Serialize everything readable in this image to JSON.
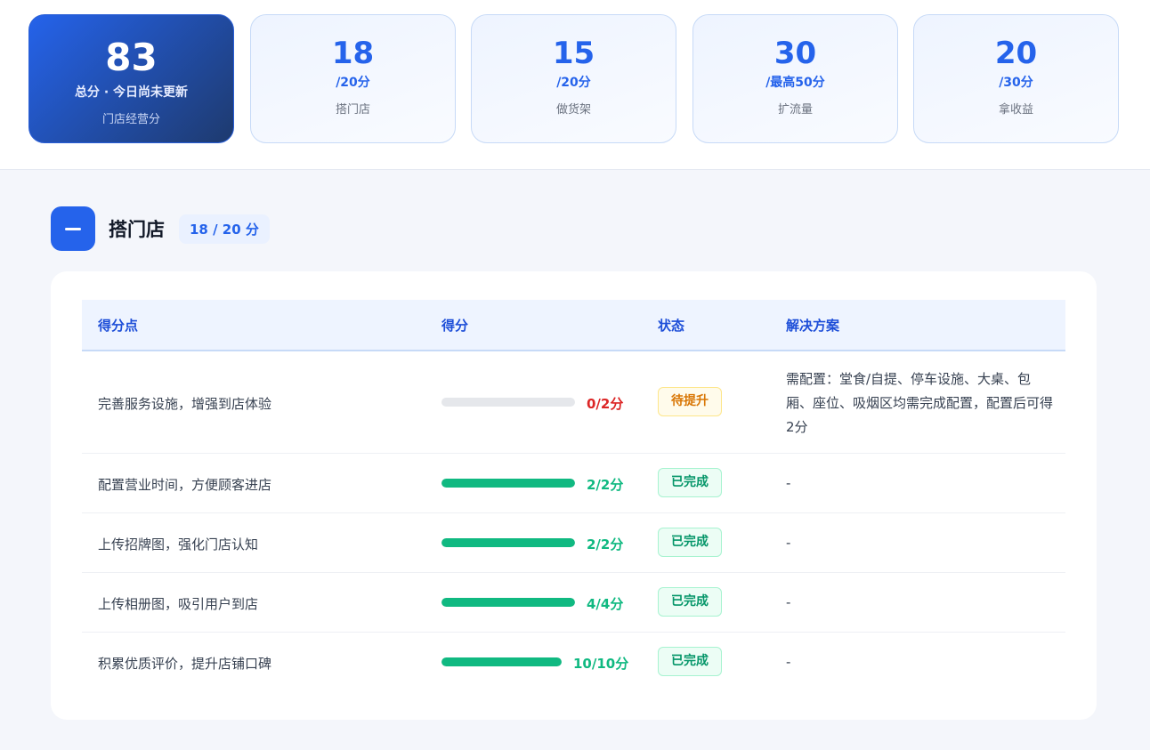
{
  "summary": {
    "total": {
      "value": "83",
      "subtitle": "总分 · 今日尚未更新",
      "caption": "门店经营分"
    },
    "cards": [
      {
        "value": "18",
        "max": "/20分",
        "caption": "搭门店"
      },
      {
        "value": "15",
        "max": "/20分",
        "caption": "做货架"
      },
      {
        "value": "30",
        "max": "/最高50分",
        "caption": "扩流量"
      },
      {
        "value": "20",
        "max": "/30分",
        "caption": "拿收益"
      }
    ]
  },
  "section": {
    "title": "搭门店",
    "score_pill": "18 / 20 分",
    "collapse_icon": "minus-icon"
  },
  "table": {
    "headers": [
      "得分点",
      "得分",
      "状态",
      "解决方案"
    ],
    "rows": [
      {
        "point": "完善服务设施，增强到店体验",
        "score": "0/2分",
        "progress": 0,
        "status": "待提升",
        "status_type": "pending",
        "solution": "需配置：堂食/自提、停车设施、大桌、包厢、座位、吸烟区均需完成配置，配置后可得2分"
      },
      {
        "point": "配置营业时间，方便顾客进店",
        "score": "2/2分",
        "progress": 1,
        "status": "已完成",
        "status_type": "done",
        "solution": "-"
      },
      {
        "point": "上传招牌图，强化门店认知",
        "score": "2/2分",
        "progress": 1,
        "status": "已完成",
        "status_type": "done",
        "solution": "-"
      },
      {
        "point": "上传相册图，吸引用户到店",
        "score": "4/4分",
        "progress": 1,
        "status": "已完成",
        "status_type": "done",
        "solution": "-"
      },
      {
        "point": "积累优质评价，提升店铺口碑",
        "score": "10/10分",
        "progress": 1,
        "status": "已完成",
        "status_type": "done",
        "solution": "-"
      }
    ]
  },
  "colors": {
    "accent": "#2563eb",
    "success": "#10b981",
    "danger": "#dc2626",
    "warning": "#d97706"
  }
}
